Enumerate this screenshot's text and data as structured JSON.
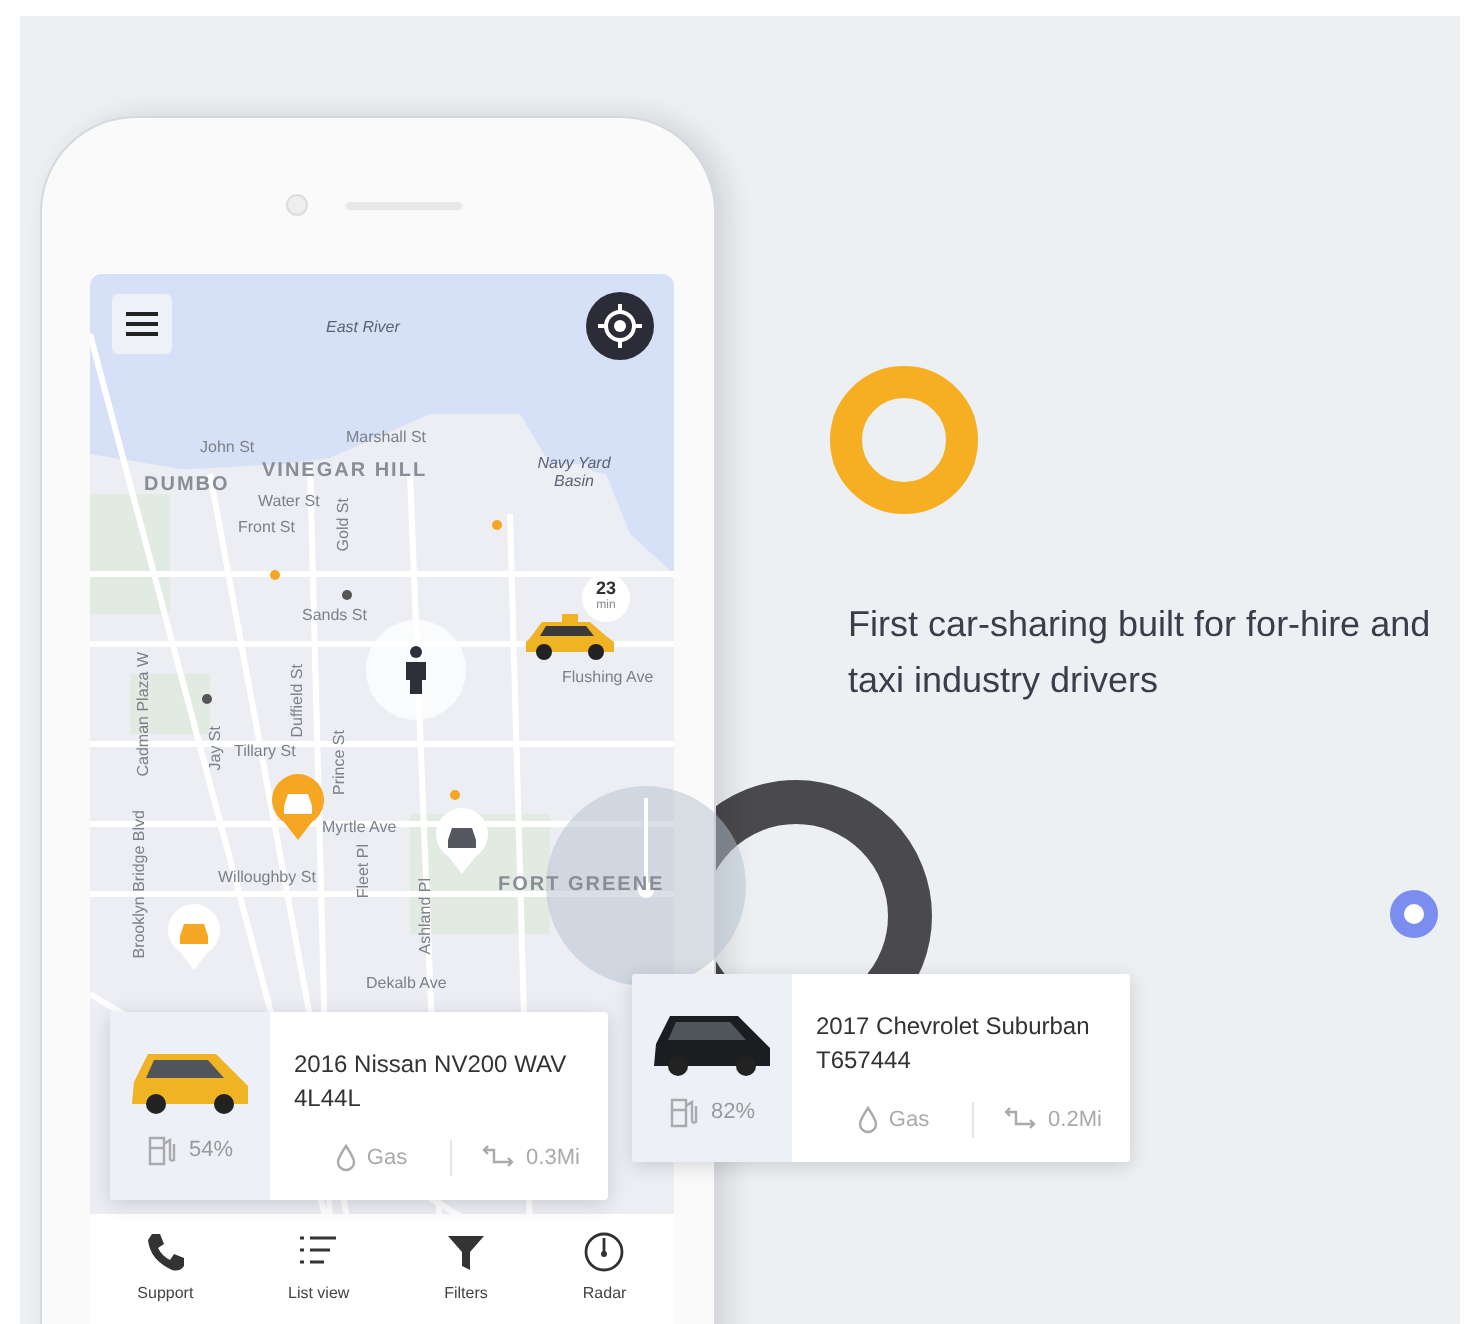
{
  "map": {
    "labels": [
      {
        "text": "East River",
        "kind": "water"
      },
      {
        "text": "DUMBO",
        "kind": "district"
      },
      {
        "text": "VINEGAR HILL",
        "kind": "district"
      },
      {
        "text": "John St",
        "kind": "street"
      },
      {
        "text": "Marshall St",
        "kind": "street"
      },
      {
        "text": "Water St",
        "kind": "street"
      },
      {
        "text": "Front St",
        "kind": "street"
      },
      {
        "text": "Navy Yard Basin",
        "kind": "water"
      },
      {
        "text": "Sands St",
        "kind": "street"
      },
      {
        "text": "Flushing Ave",
        "kind": "street"
      },
      {
        "text": "Tillary St",
        "kind": "street"
      },
      {
        "text": "Myrtle Ave",
        "kind": "street"
      },
      {
        "text": "Willoughby St",
        "kind": "street"
      },
      {
        "text": "FORT GREENE",
        "kind": "district"
      },
      {
        "text": "Dekalb Ave",
        "kind": "street"
      },
      {
        "text": "Gold St",
        "kind": "vertical"
      },
      {
        "text": "Duffield St",
        "kind": "vertical"
      },
      {
        "text": "Jay St",
        "kind": "vertical"
      },
      {
        "text": "Prince St",
        "kind": "vertical"
      },
      {
        "text": "Fleet Pl",
        "kind": "vertical"
      },
      {
        "text": "Ashland Pl",
        "kind": "vertical"
      },
      {
        "text": "Brooklyn Bridge Blvd",
        "kind": "vertical"
      },
      {
        "text": "Cadman Plaza W",
        "kind": "vertical"
      }
    ],
    "eta": {
      "value": "23",
      "unit": "min"
    },
    "pins": [
      {
        "kind": "filled",
        "color": "#f5a623"
      },
      {
        "kind": "outlined",
        "color": "#55585f"
      },
      {
        "kind": "outlined",
        "color": "#f5a623"
      }
    ]
  },
  "cards": [
    {
      "title": "2016 Nissan NV200 WAV",
      "plate": "4L44L",
      "charge": "54%",
      "fuel": "Gas",
      "distance": "0.3Mi",
      "color": "#f0b323"
    },
    {
      "title": "2017 Chevrolet Suburban",
      "plate": "T657444",
      "charge": "82%",
      "fuel": "Gas",
      "distance": "0.2Mi",
      "color": "#1c1d20"
    }
  ],
  "nav": [
    {
      "label": "Support",
      "kind": "phone"
    },
    {
      "label": "List view",
      "kind": "list"
    },
    {
      "label": "Filters",
      "kind": "filter"
    },
    {
      "label": "Radar",
      "kind": "radar"
    }
  ],
  "headline": "First car-sharing built for for-hire and taxi industry drivers"
}
